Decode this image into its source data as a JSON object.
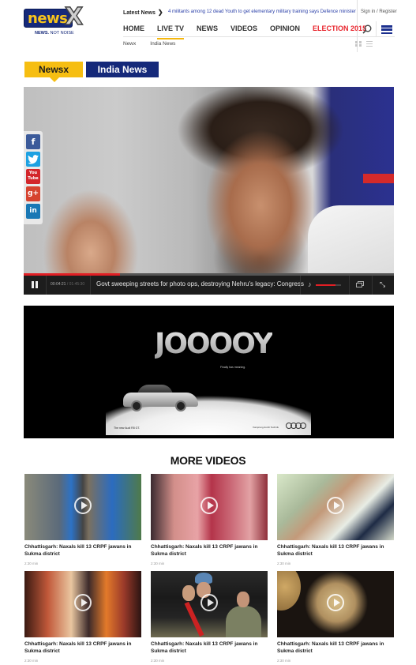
{
  "header": {
    "logo": {
      "text": "news",
      "mark": "X",
      "tagline_bold": "NEWS.",
      "tagline_rest": " NOT NOISE"
    },
    "latest_news_label": "Latest News",
    "latest_news_arrow": "❯",
    "ticker": "4 militants among 12 dead Youth to get elementary military training says Defence minister",
    "signin": "Sign in / Register",
    "nav": [
      {
        "label": "HOME",
        "active": false
      },
      {
        "label": "LIVE TV",
        "active": true
      },
      {
        "label": "NEWS",
        "active": false
      },
      {
        "label": "VIDEOS",
        "active": false
      },
      {
        "label": "OPINION",
        "active": false
      },
      {
        "label": "ELECTION 2015",
        "active": false,
        "highlight_color": "#e8262e"
      }
    ],
    "search_icon": "search-icon",
    "menu_icon": "hamburger-menu-icon",
    "subnav": [
      "Newx",
      "India News"
    ],
    "view_icons": [
      "grid-view-icon",
      "list-view-icon"
    ]
  },
  "channel_tabs": [
    {
      "label": "Newsx",
      "active": true,
      "color": "#f6be12"
    },
    {
      "label": "India News",
      "active": false,
      "color": "#15297a"
    }
  ],
  "player": {
    "current_time": "00:04:21",
    "total_time": "01:45:30",
    "progress_fraction": 0.26,
    "volume_fraction": 0.78,
    "title": "Govt sweeping streets for photo ops, destroying Nehru's legacy: Congress",
    "icons": [
      "pause-icon",
      "volume-icon",
      "picture-in-picture-icon",
      "fullscreen-icon"
    ]
  },
  "social": [
    {
      "name": "facebook",
      "glyph": "f"
    },
    {
      "name": "twitter",
      "glyph": "🐦"
    },
    {
      "name": "youtube",
      "glyph": "You Tube"
    },
    {
      "name": "google-plus",
      "glyph": "g+"
    },
    {
      "name": "linkedin",
      "glyph": "in"
    }
  ],
  "ad": {
    "headline": "JOOOOY",
    "tagline": "Finally has meaning.",
    "caption": "The new Audi R8 GT.",
    "brand_line": "Vorsprung durch Technik",
    "brand": "Audi"
  },
  "more_videos": {
    "title": "MORE VIDEOS",
    "items": [
      {
        "title": "Chhattisgarh: Naxals kill 13 CRPF jawans in Sukma district",
        "duration": "2:30 min"
      },
      {
        "title": "Chhattisgarh: Naxals kill 13 CRPF jawans in Sukma district",
        "duration": "2:30 min"
      },
      {
        "title": "Chhattisgarh: Naxals kill 13 CRPF jawans in Sukma district",
        "duration": "2:30 min"
      },
      {
        "title": "Chhattisgarh: Naxals kill 13 CRPF jawans in Sukma district",
        "duration": "2:30 min"
      },
      {
        "title": "Chhattisgarh: Naxals kill 13 CRPF jawans in Sukma district",
        "duration": "2:30 min"
      },
      {
        "title": "Chhattisgarh: Naxals kill 13 CRPF jawans in Sukma district",
        "duration": "2:30 min"
      }
    ]
  }
}
